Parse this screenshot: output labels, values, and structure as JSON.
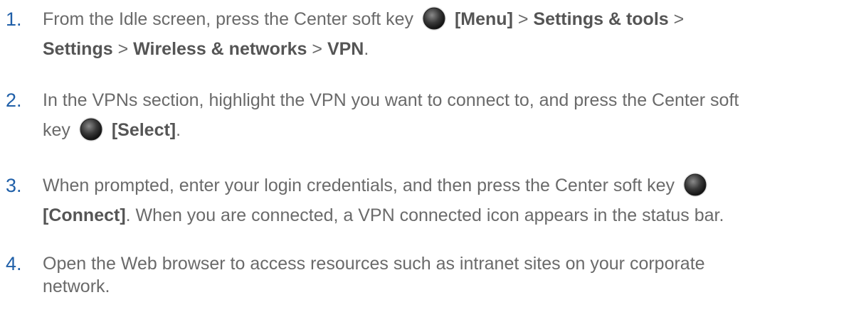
{
  "steps": [
    {
      "number": "1.",
      "l1a": "From the Idle screen, press the Center soft key",
      "l1b": "[Menu]",
      "l1c": " > ",
      "l1d": "Settings & tools",
      "l1e": " >",
      "l2a": "Settings",
      "l2b": " > ",
      "l2c": "Wireless & networks",
      "l2d": " > ",
      "l2e": "VPN",
      "l2f": "."
    },
    {
      "number": "2.",
      "l1a": "In the VPNs section, highlight the VPN you want to connect to, and press the Center soft",
      "l2a": "key",
      "l2b": "[Select]",
      "l2c": "."
    },
    {
      "number": "3.",
      "l1a": "When prompted, enter your login credentials, and then press the Center soft key",
      "l2a": "[Connect]",
      "l2b": ". When you are connected, a VPN connected icon appears in the status bar."
    },
    {
      "number": "4.",
      "l1a": "Open the Web browser to access resources such as intranet sites on your corporate",
      "l2a": "network."
    }
  ],
  "icons": {
    "center_key": "center-soft-key-icon"
  },
  "colors": {
    "number": "#1f5fa8",
    "text": "#6a6a6a",
    "bold": "#555555"
  }
}
